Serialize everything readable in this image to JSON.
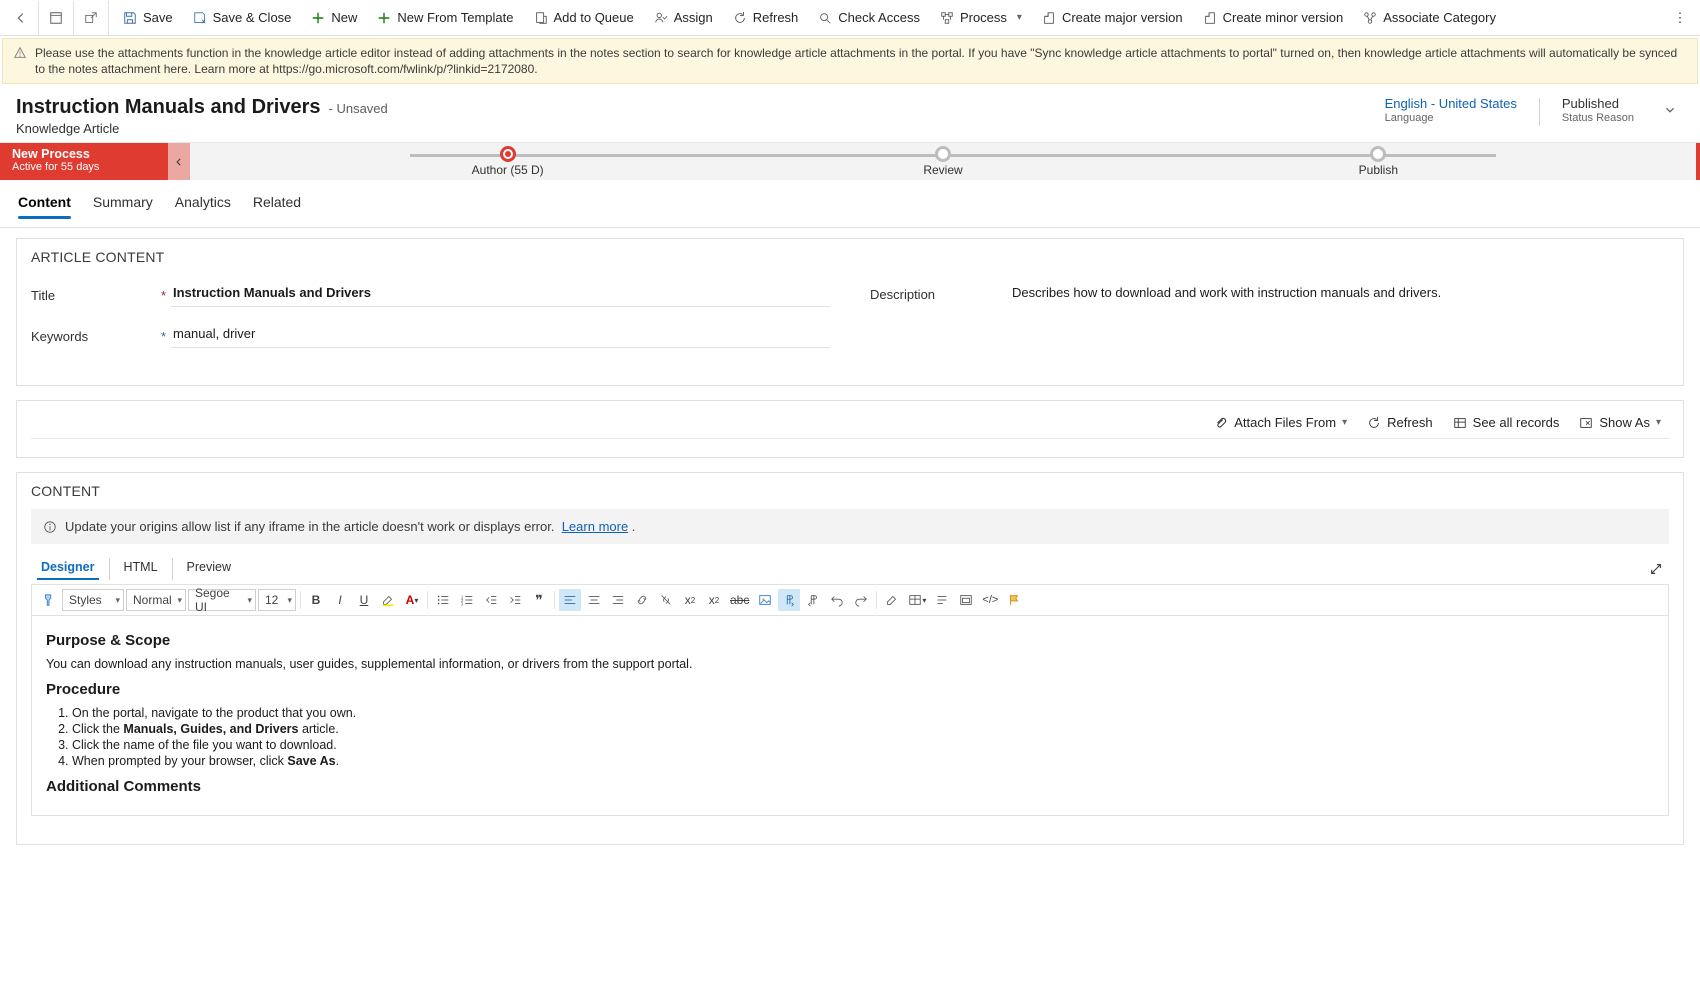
{
  "commands": {
    "save": "Save",
    "save_close": "Save & Close",
    "new": "New",
    "new_template": "New From Template",
    "add_queue": "Add to Queue",
    "assign": "Assign",
    "refresh": "Refresh",
    "check_access": "Check Access",
    "process": "Process",
    "create_major": "Create major version",
    "create_minor": "Create minor version",
    "associate": "Associate Category"
  },
  "notice": "Please use the attachments function in the knowledge article editor instead of adding attachments in the notes section to search for knowledge article attachments in the portal. If you have \"Sync knowledge article attachments to portal\" turned on, then knowledge article attachments will automatically be synced to the notes attachment here. Learn more at https://go.microsoft.com/fwlink/p/?linkid=2172080.",
  "header": {
    "title": "Instruction Manuals and Drivers",
    "unsaved": "- Unsaved",
    "entity": "Knowledge Article",
    "language": {
      "value": "English - United States",
      "label": "Language"
    },
    "status": {
      "value": "Published",
      "label": "Status Reason"
    }
  },
  "bpf": {
    "name": "New Process",
    "duration": "Active for 55 days",
    "stages": [
      {
        "label": "Author  (55 D)",
        "active": true
      },
      {
        "label": "Review",
        "active": false
      },
      {
        "label": "Publish",
        "active": false
      }
    ]
  },
  "tabs": [
    "Content",
    "Summary",
    "Analytics",
    "Related"
  ],
  "active_tab": 0,
  "article_section": {
    "title": "ARTICLE CONTENT",
    "fields": {
      "title": {
        "label": "Title",
        "value": "Instruction Manuals and Drivers"
      },
      "keywords": {
        "label": "Keywords",
        "value": "manual, driver"
      },
      "description": {
        "label": "Description",
        "value": "Describes how to download and work with instruction manuals and drivers."
      }
    }
  },
  "attach": {
    "attach_files": "Attach Files From",
    "refresh": "Refresh",
    "see_all": "See all records",
    "show_as": "Show As"
  },
  "content_section": {
    "title": "CONTENT",
    "banner": "Update your origins allow list if any iframe in the article doesn't work or displays error.",
    "learn_more": "Learn more",
    "editor_tabs": [
      "Designer",
      "HTML",
      "Preview"
    ],
    "toolbar": {
      "styles": "Styles",
      "normal": "Normal",
      "font": "Segoe UI",
      "size": "12"
    },
    "body": {
      "h1": "Purpose & Scope",
      "p1": "You can download any instruction manuals, user guides, supplemental information, or drivers from the support portal.",
      "h2": "Procedure",
      "li1a": "On the portal, navigate to the product that you own.",
      "li2a": "Click the ",
      "li2b": "Manuals, Guides, and Drivers",
      "li2c": " article.",
      "li3a": "Click the name of the file you want to download.",
      "li4a": "When prompted by your browser, click ",
      "li4b": "Save As",
      "li4c": ".",
      "h3": "Additional Comments"
    }
  }
}
